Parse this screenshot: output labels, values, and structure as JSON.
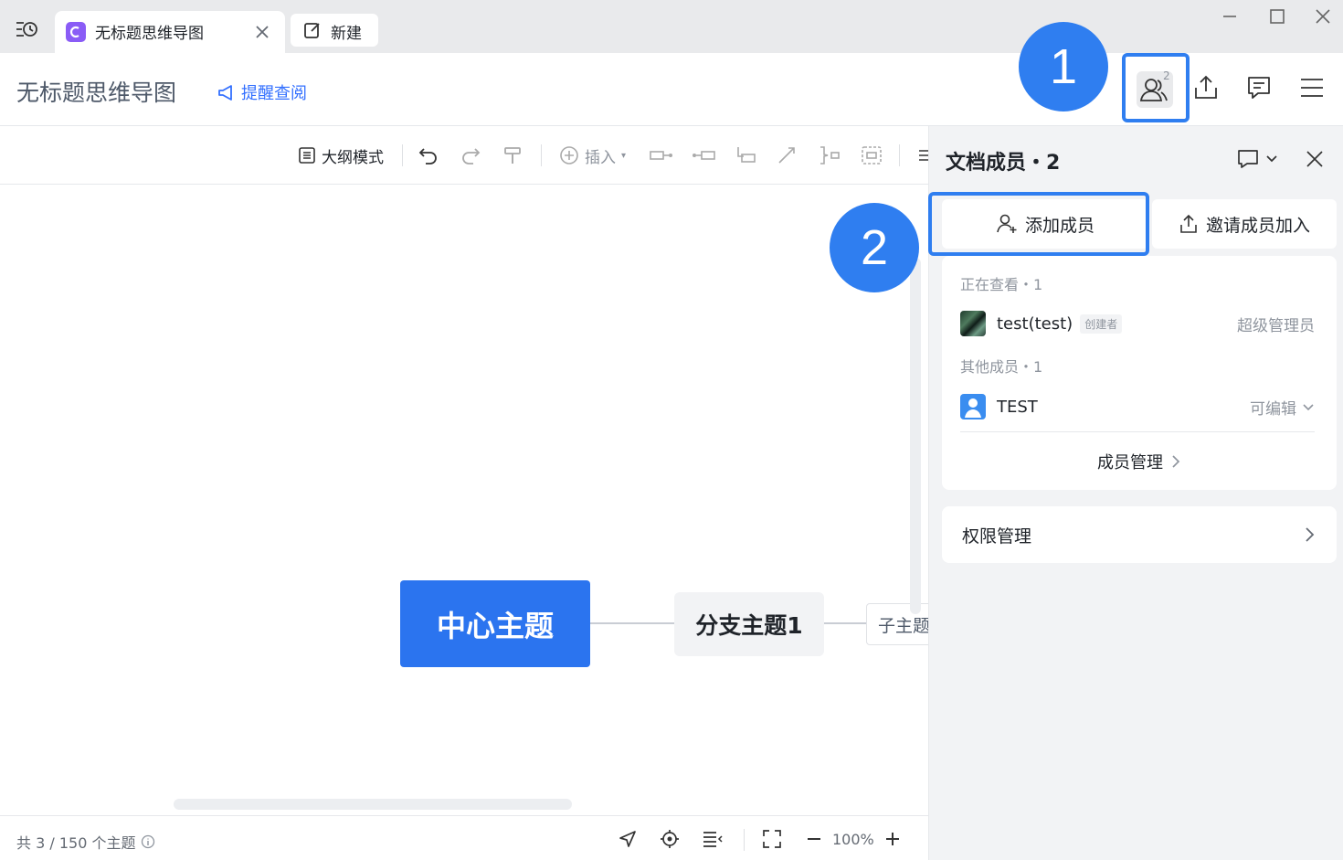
{
  "tabs": [
    {
      "label": "无标题思维导图",
      "active": true
    },
    {
      "label": "新建",
      "active": false
    }
  ],
  "header": {
    "title": "无标题思维导图",
    "remind_label": "提醒查阅",
    "collaborator_count": "2"
  },
  "toolbar": {
    "outline_label": "大纲模式",
    "insert_label": "插入"
  },
  "mindmap": {
    "center": "中心主题",
    "branch": "分支主题1",
    "sub": "子主题"
  },
  "status": {
    "topics": "共 3 / 150 个主题",
    "zoom": "100%"
  },
  "panel": {
    "title": "文档成员・2",
    "add_member": "添加成员",
    "invite_member": "邀请成员加入",
    "viewing_label": "正在查看・1",
    "others_label": "其他成员・1",
    "members": [
      {
        "name": "test(test)",
        "badge": "创建者",
        "role": "超级管理员"
      },
      {
        "name": "TEST",
        "role": "可编辑"
      }
    ],
    "manage_label": "成员管理",
    "permission_label": "权限管理"
  },
  "callouts": [
    "1",
    "2"
  ],
  "colors": {
    "accent": "#2f7ef0",
    "center_node": "#2b74ef",
    "link": "#3370ff"
  }
}
